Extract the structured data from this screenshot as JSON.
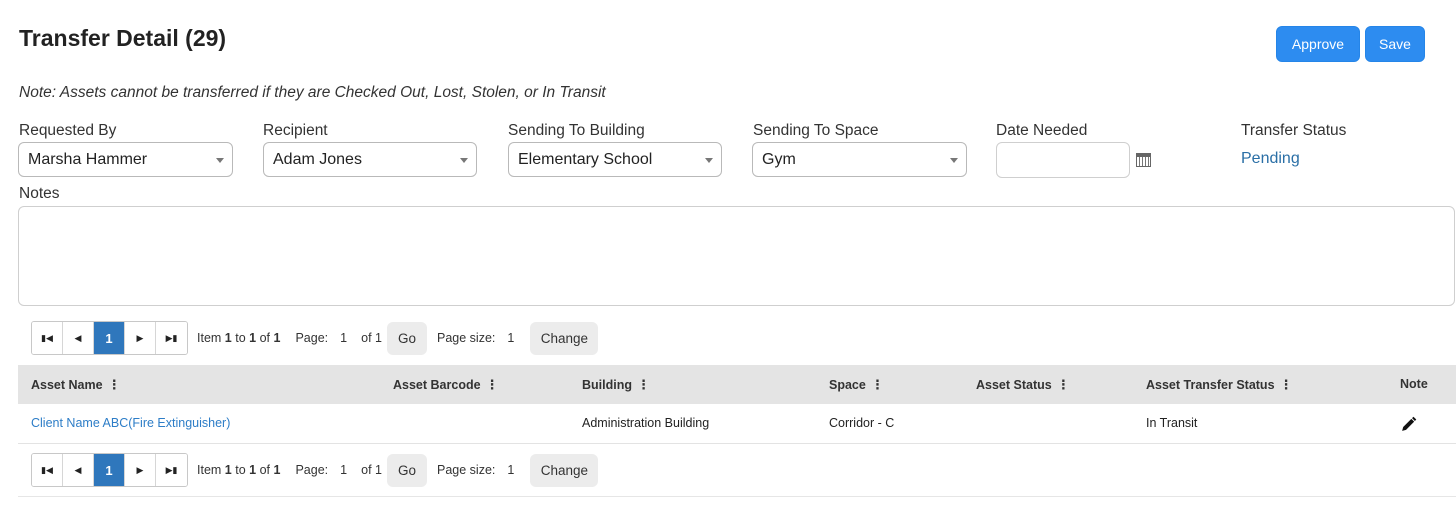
{
  "page": {
    "title": "Transfer Detail (29)",
    "note": "Note: Assets cannot be transferred if they are Checked Out, Lost, Stolen, or In Transit"
  },
  "toolbar": {
    "approve_label": "Approve",
    "save_label": "Save"
  },
  "form": {
    "requested_by": {
      "label": "Requested By",
      "value": "Marsha Hammer"
    },
    "recipient": {
      "label": "Recipient",
      "value": "Adam Jones"
    },
    "sending_to_building": {
      "label": "Sending To Building",
      "value": "Elementary School"
    },
    "sending_to_space": {
      "label": "Sending To Space",
      "value": "Gym"
    },
    "date_needed": {
      "label": "Date Needed",
      "value": ""
    },
    "transfer_status": {
      "label": "Transfer Status",
      "value": "Pending"
    },
    "notes": {
      "label": "Notes",
      "value": ""
    }
  },
  "pager": {
    "current_page": "1",
    "item_prefix": "Item",
    "item_from": "1",
    "item_to_word": "to",
    "item_to": "1",
    "item_of_word": "of",
    "item_total": "1",
    "page_label": "Page:",
    "page_value": "1",
    "page_of": "of 1",
    "go_label": "Go",
    "page_size_label": "Page size:",
    "page_size_value": "1",
    "change_label": "Change"
  },
  "grid": {
    "columns": [
      "Asset Name",
      "Asset Barcode",
      "Building",
      "Space",
      "Asset Status",
      "Asset Transfer Status",
      "Note"
    ],
    "rows": [
      {
        "asset_name": "Client Name ABC(Fire Extinguisher)",
        "asset_barcode": "",
        "building": "Administration Building",
        "space": "Corridor - C",
        "asset_status": "",
        "asset_transfer_status": "In Transit"
      }
    ]
  },
  "icons": {
    "first_page": "first-page-icon",
    "prev_page": "prev-page-icon",
    "next_page": "next-page-icon",
    "last_page": "last-page-icon",
    "calendar": "calendar-icon",
    "edit": "pencil-icon",
    "column_menu": "kebab-menu-icon"
  },
  "colors": {
    "primary": "#2d8cf0",
    "link": "#2d7dc7",
    "status": "#2a6fa6",
    "pager_active": "#2f77bc"
  }
}
